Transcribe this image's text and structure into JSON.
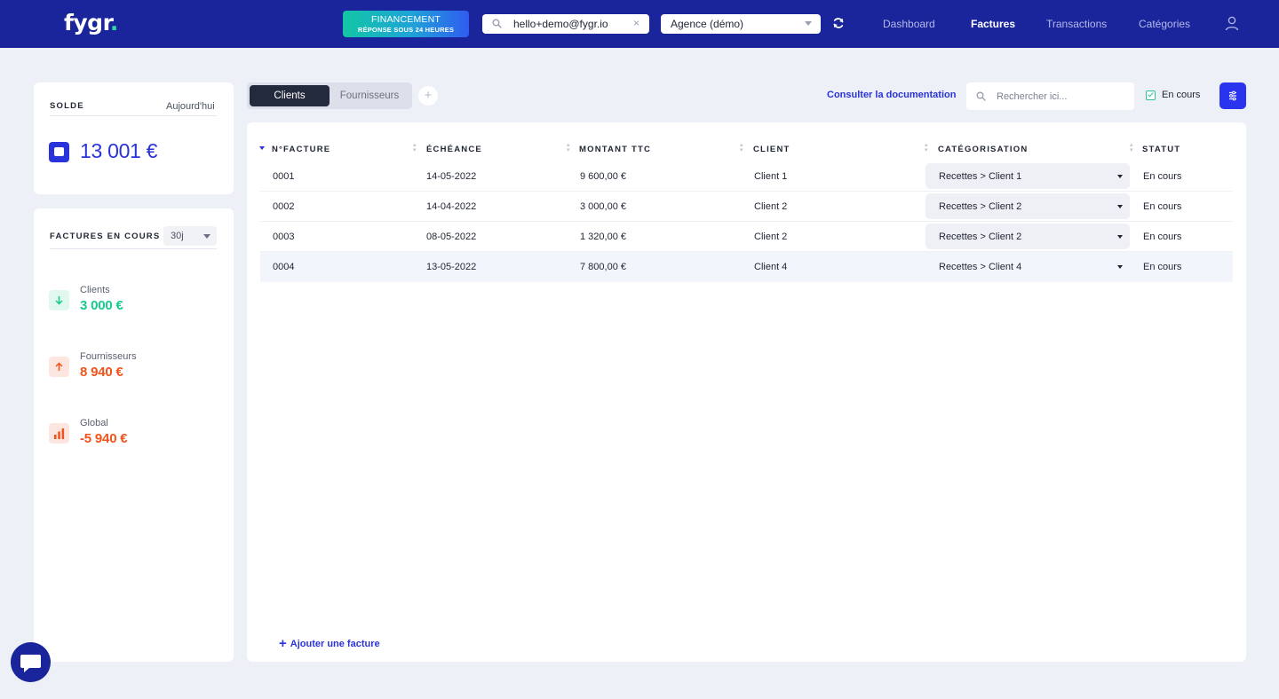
{
  "colors": {
    "topbar": "#1a259c",
    "accent": "#2a33d9",
    "positive": "#18c98e",
    "negative": "#f0531c",
    "background": "#eef0f8"
  },
  "header": {
    "logo_text": "fygr",
    "logo_dot": ".",
    "financement_line1": "FINANCEMENT",
    "financement_line2": "RÉPONSE SOUS 24 HEURES",
    "account_email": "hello+demo@fygr.io",
    "clear_icon": "×",
    "agency_selected": "Agence (démo)",
    "nav": [
      {
        "label": "Dashboard",
        "active": false
      },
      {
        "label": "Factures",
        "active": true
      },
      {
        "label": "Transactions",
        "active": false
      },
      {
        "label": "Catégories",
        "active": false
      }
    ],
    "icons": [
      "search-icon",
      "refresh-icon",
      "user-icon"
    ]
  },
  "solde": {
    "title": "SOLDE",
    "date_label": "Aujourd'hui",
    "amount": "13 001 €",
    "icon": "wallet-icon"
  },
  "factures_en_cours": {
    "title": "FACTURES EN COURS",
    "period": "30j",
    "stats": [
      {
        "label": "Clients",
        "value": "3 000 €",
        "icon": "arrow-down-icon"
      },
      {
        "label": "Fournisseurs",
        "value": "8 940 €",
        "icon": "arrow-up-icon"
      },
      {
        "label": "Global",
        "value": "-5 940 €",
        "icon": "bar-chart-icon"
      }
    ]
  },
  "toolbar": {
    "tabs": [
      {
        "label": "Clients",
        "active": true
      },
      {
        "label": "Fournisseurs",
        "active": false
      }
    ],
    "add_tab": "+",
    "doc_link": "Consulter la documentation",
    "search_placeholder": "Rechercher ici...",
    "filter_en_cours": {
      "label": "En cours",
      "checked": true
    }
  },
  "table": {
    "columns": [
      "N°FACTURE",
      "ÉCHÉANCE",
      "MONTANT TTC",
      "CLIENT",
      "CATÉGORISATION",
      "STATUT"
    ],
    "rows": [
      {
        "numero": "0001",
        "echeance": "14-05-2022",
        "montant": "9 600,00 €",
        "client": "Client 1",
        "categorisation": "Recettes > Client 1",
        "statut": "En cours"
      },
      {
        "numero": "0002",
        "echeance": "14-04-2022",
        "montant": "3 000,00 €",
        "client": "Client 2",
        "categorisation": "Recettes > Client 2",
        "statut": "En cours"
      },
      {
        "numero": "0003",
        "echeance": "08-05-2022",
        "montant": "1 320,00 €",
        "client": "Client 2",
        "categorisation": "Recettes > Client 2",
        "statut": "En cours"
      },
      {
        "numero": "0004",
        "echeance": "13-05-2022",
        "montant": "7 800,00 €",
        "client": "Client 4",
        "categorisation": "Recettes > Client 4",
        "statut": "En cours"
      }
    ],
    "add_label": "Ajouter une facture"
  }
}
